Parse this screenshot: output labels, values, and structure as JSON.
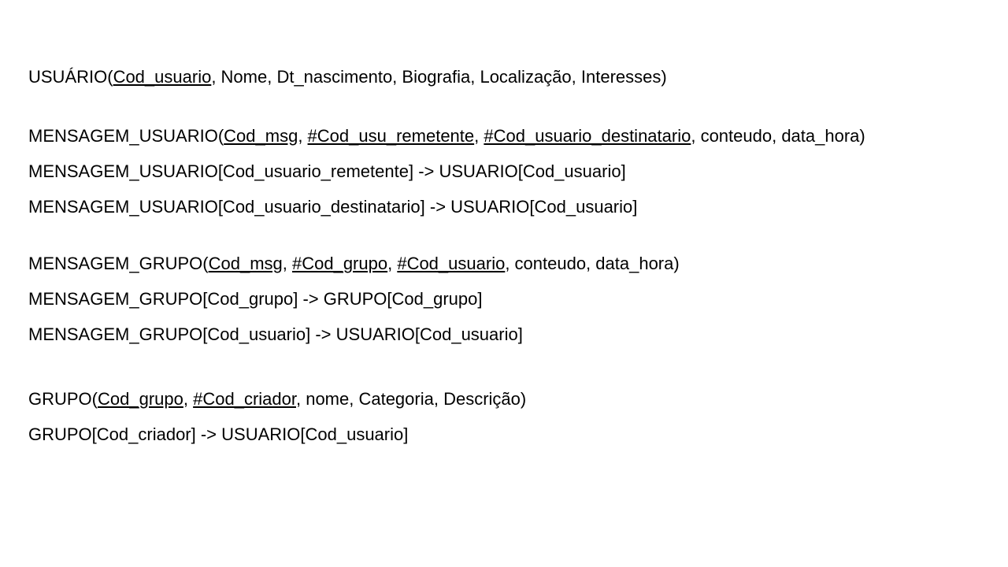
{
  "usuario": {
    "name": "USUÁRIO(",
    "pk": "Cod_usuario",
    "rest": ", Nome, Dt_nascimento, Biografia, Localização, Interesses)"
  },
  "mensagem_usuario": {
    "name": "MENSAGEM_USUARIO(",
    "pk": "Cod_msg",
    "sep1": ", ",
    "fk1": "#Cod_usu_remetente",
    "sep2": ", ",
    "fk2": "#Cod_usuario_destinatario",
    "rest": ", conteudo, data_hora)",
    "ref1": "MENSAGEM_USUARIO[Cod_usuario_remetente] -> USUARIO[Cod_usuario]",
    "ref2": "MENSAGEM_USUARIO[Cod_usuario_destinatario] -> USUARIO[Cod_usuario]"
  },
  "mensagem_grupo": {
    "name": "MENSAGEM_GRUPO(",
    "pk": "Cod_msg",
    "sep1": ", ",
    "fk1": "#Cod_grupo",
    "sep2": ", ",
    "fk2": "#Cod_usuario",
    "rest": ", conteudo, data_hora)",
    "ref1": "MENSAGEM_GRUPO[Cod_grupo] -> GRUPO[Cod_grupo]",
    "ref2": "MENSAGEM_GRUPO[Cod_usuario] -> USUARIO[Cod_usuario]"
  },
  "grupo": {
    "name": "GRUPO(",
    "pk": "Cod_grupo",
    "sep1": ", ",
    "fk1": "#Cod_criador",
    "rest": ", nome, Categoria, Descrição)",
    "ref1": "GRUPO[Cod_criador] -> USUARIO[Cod_usuario]"
  }
}
